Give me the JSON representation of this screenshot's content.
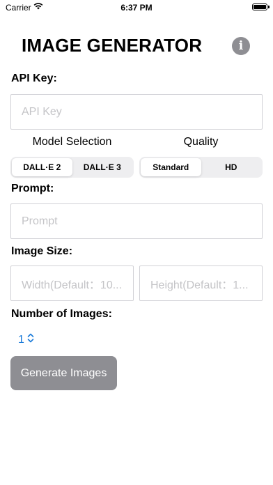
{
  "status_bar": {
    "carrier": "Carrier",
    "time": "6:37 PM"
  },
  "header": {
    "title": "IMAGE GENERATOR",
    "info_icon_glyph": "i"
  },
  "api_key": {
    "label": "API Key:",
    "placeholder": "API Key",
    "value": ""
  },
  "model_selection": {
    "label": "Model Selection",
    "options": [
      "DALL·E 2",
      "DALL·E 3"
    ],
    "selected": "DALL·E 2"
  },
  "quality": {
    "label": "Quality",
    "options": [
      "Standard",
      "HD"
    ],
    "selected": "Standard"
  },
  "prompt": {
    "label": "Prompt:",
    "placeholder": "Prompt",
    "value": ""
  },
  "image_size": {
    "label": "Image Size:",
    "width_placeholder": "Width(Default：10...",
    "height_placeholder": "Height(Default：1..."
  },
  "number_of_images": {
    "label": "Number of Images:",
    "value": "1"
  },
  "generate_button": {
    "label": "Generate Images",
    "color": "#8e8e93"
  },
  "colors": {
    "accent": "#1a7ad9",
    "placeholder": "#c4c4c7",
    "border": "#d1d1d6"
  }
}
